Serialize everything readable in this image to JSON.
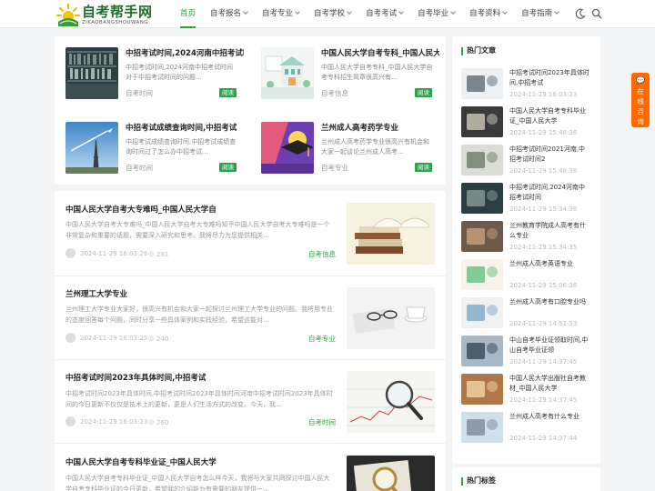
{
  "logo": {
    "title": "自考帮手网",
    "subtitle": "ZIKAOBANGSHOUWANG"
  },
  "nav": [
    {
      "label": "首页",
      "dropdown": false
    },
    {
      "label": "自考报名",
      "dropdown": true
    },
    {
      "label": "自考专业",
      "dropdown": true
    },
    {
      "label": "自考学校",
      "dropdown": true
    },
    {
      "label": "自考考试",
      "dropdown": true
    },
    {
      "label": "自考毕业",
      "dropdown": true
    },
    {
      "label": "自考资料",
      "dropdown": true
    },
    {
      "label": "自考指南",
      "dropdown": true
    }
  ],
  "grid": [
    {
      "title": "中招考试时间,2024河南中招考试时间",
      "desc": "中招考试时间,2024河南中招考试时间对于中招考试时间的问题…",
      "category": "自考时间",
      "tag": "阅读"
    },
    {
      "title": "中国人民大学自考专科_中国人民大学自考",
      "desc": "中国人民大学自考专科_中国人民大学自考专科招生简章很高兴有…",
      "category": "自考信息",
      "tag": "阅读"
    },
    {
      "title": "中招考试成绩查询时间,中招考试",
      "desc": "中招考试成绩查询时间,中招考试成绩查询时间过了怎么办中招考试…",
      "category": "自考时间",
      "tag": "阅读"
    },
    {
      "title": "兰州成人高考药学专业",
      "desc": "兰州成人高考药学专业很高兴有机会和大家一起谈论兰州成人高考…",
      "category": "自考专业",
      "tag": "阅读"
    }
  ],
  "articles": [
    {
      "title": "中国人民大学自考大专难吗_中国人民大学自",
      "desc": "中国人民大学自考大专难吗_中国人民大学自考大专难吗知乎中国人民大学自考大专难吗是一个非常复杂和重要的话题，需要深入研究和思考。我将尽力为您提供相关…",
      "date": "2024-11-29 16:03:26",
      "views": "291",
      "category": "自考信息"
    },
    {
      "title": "兰州理工大学专业",
      "desc": "兰州理工大学专业大家好，很高兴有机会和大家一起探讨兰州理工大学专业的问题。我将用专业的态度回答每个问题，同时分享一些具体案例和实践经验，希望这能对…",
      "date": "2024-11-29 16:03:25",
      "views": "240",
      "category": "自考专业"
    },
    {
      "title": "中招考试时间2023年具体时间,中招考试",
      "desc": "中招考试时间2023年具体时间,中招考试时间2023年具体时间河南中招考试时间2023年具体时间的今日更新不仅仅是技术上的更新，更是人们生活方式的改变。今天，我…",
      "date": "2024-11-29 16:03:23",
      "views": "260",
      "category": "自考时间"
    },
    {
      "title": "中国人民大学自考专科毕业证_中国人民大学",
      "desc": "中国人民大学自考专科毕业证_中国人民大学自考怎么样今天，我将与大家共同探讨中国人民大学自考专科毕业证的今日更新，希望我的介绍能为有需要的朋友提供一…",
      "date": "",
      "views": "",
      "category": ""
    }
  ],
  "sidebar": {
    "hot_title": "热门文章",
    "hot": [
      {
        "title": "中招考试时间2023年具体时间,中招考试",
        "date": "2024-11-29 16:03:23"
      },
      {
        "title": "中国人民大学自考专科毕业证_中国人民大学",
        "date": "2024-11-29 15:48:36"
      },
      {
        "title": "中招考试时间2021河南,中招考试时间2",
        "date": "2024-11-29 15:48:36"
      },
      {
        "title": "中招考试时间,2024河南中招考试时间",
        "date": "2024-11-29 15:34:36"
      },
      {
        "title": "兰州教育学院成人高考有什么专业",
        "date": "2024-11-29 15:34:35"
      },
      {
        "title": "兰州成人高考英语专业",
        "date": "2024-11-29 15:06:36"
      },
      {
        "title": "兰州成人高考有口腔专业吗",
        "date": "2024-11-29 14:52:53"
      },
      {
        "title": "中山自考毕业证领取时间,中山自考毕业证领",
        "date": "2024-11-29 14:37:45"
      },
      {
        "title": "中国人民大学出版社自考教材_中国人民大学",
        "date": "2024-11-29 14:37:45"
      },
      {
        "title": "兰州成人高考有什么专业",
        "date": "2024-11-29 14:37:44"
      }
    ],
    "tags_title": "热门标签"
  },
  "consult": "在线咨询"
}
